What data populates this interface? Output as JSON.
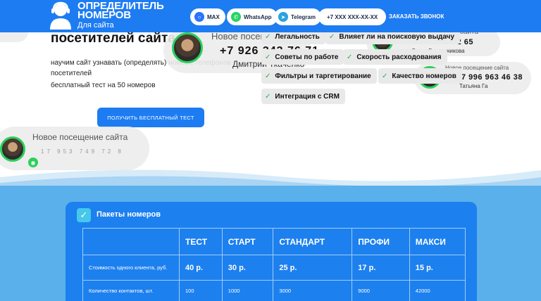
{
  "header": {
    "logo_title": "ОПРЕДЕЛИТЕЛЬ НОМЕРОВ",
    "logo_title_line1": "ОПРЕДЕЛИТЕЛЬ",
    "logo_title_line2": "НОМЕРОВ",
    "logo_subtitle": "Для сайта",
    "buttons": [
      {
        "label": "MAX",
        "icon": "max-icon",
        "color": "#2a73ff"
      },
      {
        "label": "WhatsApp",
        "icon": "whatsapp-icon",
        "color": "#25d366"
      },
      {
        "label": "Telegram",
        "icon": "telegram-icon",
        "color": "#2aa3e0"
      },
      {
        "label": "+7 XXX XXX-XX-XX",
        "icon": "",
        "color": ""
      }
    ],
    "callback_label": "ЗАКАЗАТЬ ЗВОНОК",
    "bg_color": "#1d7cf2"
  },
  "hero": {
    "title": "посетителей сайта",
    "description": "научим сайт узнавать (определять) номера телефонов посетителей",
    "free_test": "бесплатный тест на 50 номеров",
    "cta_label": "ПОЛУЧИТЬ БЕСПЛАТНЫЙ ТЕСТ"
  },
  "visits": [
    {
      "label": "Новое посещение сайта",
      "phone": "+7 926 343 76 71",
      "name": "Дмитрий Ткаченко"
    },
    {
      "label": "Новое посещение сайта",
      "phone": "17 953 749 72 8",
      "name": ""
    },
    {
      "label": "с сайта",
      "phone": "+7 903 530 52 65",
      "name": "Ольга Бескудникова"
    },
    {
      "label": "Новое посещение сайта",
      "phone": "+7 996 963 46 38",
      "name": "Татьяна Га"
    }
  ],
  "features": [
    "Легальность",
    "Влияет ли на поисковую выдачу",
    "Советы по работе",
    "Скорость расходования",
    "Фильтры и таргетирование",
    "Качество номеров",
    "Интеграция с CRM"
  ],
  "packages": {
    "title": "Пакеты номеров",
    "columns": [
      "",
      "ТЕСТ",
      "СТАРТ",
      "СТАНДАРТ",
      "ПРОФИ",
      "МАКСИ"
    ],
    "rows": [
      {
        "label": "Стоимость одного клиента, руб.",
        "values": [
          "40 р.",
          "30 р.",
          "25 р.",
          "17 р.",
          "15 р."
        ]
      },
      {
        "label": "Количество контактов, шт.",
        "values": [
          "100",
          "1000",
          "3000",
          "9000",
          "42000"
        ]
      }
    ]
  },
  "colors": {
    "accent": "#1d7cf2",
    "section_bg": "#5ab0ea",
    "panel_bg": "#1d80ef",
    "check_green": "#20b24a"
  }
}
